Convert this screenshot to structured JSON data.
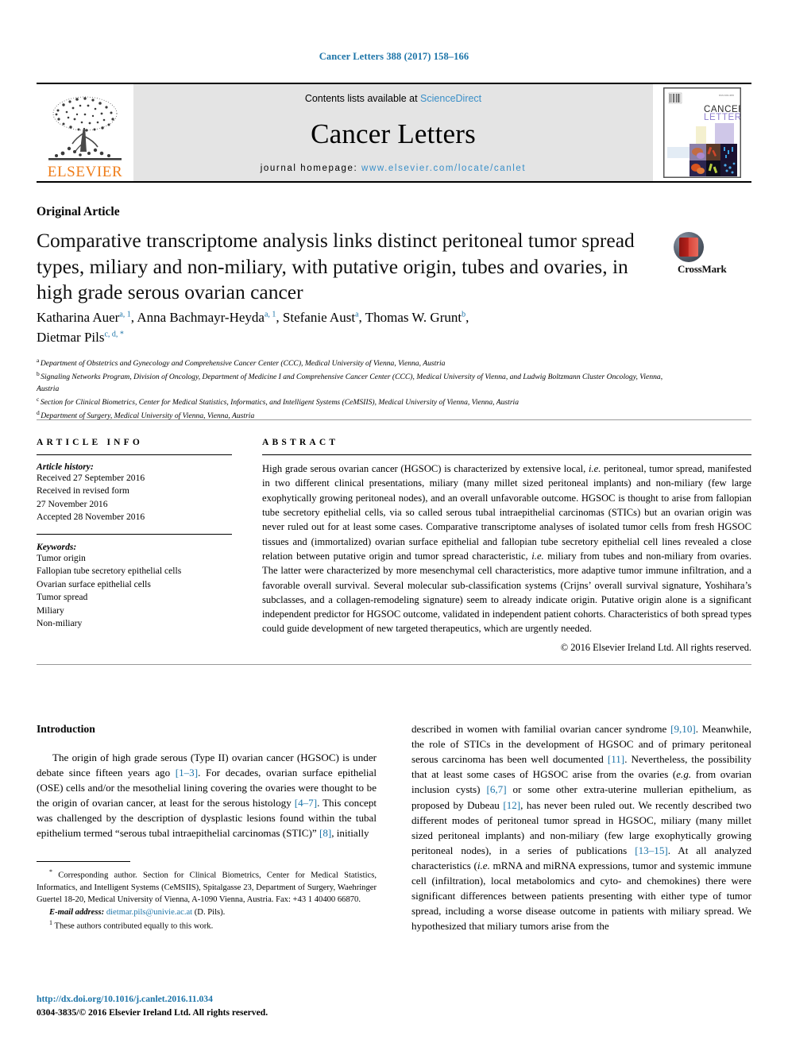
{
  "running_head": "Cancer Letters 388 (2017) 158–166",
  "masthead": {
    "contents_prefix": "Contents lists available at ",
    "contents_link": "ScienceDirect",
    "journal_title": "Cancer Letters",
    "homepage_prefix": "journal homepage: ",
    "homepage_url": "www.elsevier.com/locate/canlet",
    "publisher_wordmark": "ELSEVIER",
    "publisher_logo_icon": "elsevier-tree-icon",
    "cover_title_line1": "CANCER",
    "cover_title_line2": "LETTERS"
  },
  "article": {
    "type": "Original Article",
    "title": "Comparative transcriptome analysis links distinct peritoneal tumor spread types, miliary and non-miliary, with putative origin, tubes and ovaries, in high grade serous ovarian cancer",
    "crossmark_label": "CrossMark"
  },
  "authors": {
    "line1": "Katharina Auer",
    "line1_sup1": "a, 1",
    "a2": "Anna Bachmayr-Heyda",
    "a2_sup": "a, 1",
    "a3": "Stefanie Aust",
    "a3_sup": "a",
    "a4": "Thomas W. Grunt",
    "a4_sup": "b",
    "a5": "Dietmar Pils",
    "a5_sup": "c, d, *"
  },
  "affiliations": [
    {
      "mark": "a",
      "text": "Department of Obstetrics and Gynecology and Comprehensive Cancer Center (CCC), Medical University of Vienna, Vienna, Austria"
    },
    {
      "mark": "b",
      "text": "Signaling Networks Program, Division of Oncology, Department of Medicine I and Comprehensive Cancer Center (CCC), Medical University of Vienna, and Ludwig Boltzmann Cluster Oncology, Vienna, Austria"
    },
    {
      "mark": "c",
      "text": "Section for Clinical Biometrics, Center for Medical Statistics, Informatics, and Intelligent Systems (CeMSIIS), Medical University of Vienna, Vienna, Austria"
    },
    {
      "mark": "d",
      "text": "Department of Surgery, Medical University of Vienna, Vienna, Austria"
    }
  ],
  "article_info": {
    "heading": "ARTICLE INFO",
    "history_label": "Article history:",
    "history_lines": "Received 27 September 2016\nReceived in revised form\n27 November 2016\nAccepted 28 November 2016",
    "keywords_label": "Keywords:",
    "keywords": "Tumor origin\nFallopian tube secretory epithelial cells\nOvarian surface epithelial cells\nTumor spread\nMiliary\nNon-miliary"
  },
  "abstract": {
    "heading": "ABSTRACT",
    "copyright": "© 2016 Elsevier Ireland Ltd. All rights reserved."
  },
  "introduction": {
    "heading": "Introduction"
  },
  "footnotes": {
    "corresponding": "Corresponding author. Section for Clinical Biometrics, Center for Medical Statistics, Informatics, and Intelligent Systems (CeMSIIS), Spitalgasse 23, Department of Surgery, Waehringer Guertel 18-20, Medical University of Vienna, A-1090 Vienna, Austria. Fax: +43 1 40400 66870.",
    "email_label": "E-mail address:",
    "email": "dietmar.pils@univie.ac.at",
    "email_suffix": "(D. Pils).",
    "equal_contrib": "These authors contributed equally to this work."
  },
  "doi": {
    "url": "http://dx.doi.org/10.1016/j.canlet.2016.11.034",
    "issn_line": "0304-3835/© 2016 Elsevier Ireland Ltd. All rights reserved."
  },
  "colors": {
    "link_blue": "#1c74a8",
    "science_direct_blue": "#3a8fc8",
    "elsevier_orange": "#ef7d1a",
    "masthead_gray": "#e4e4e4"
  }
}
